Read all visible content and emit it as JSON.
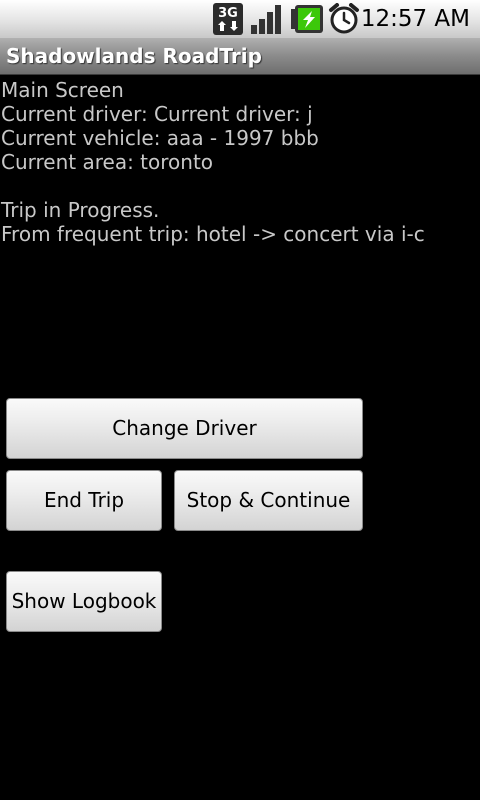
{
  "status_bar": {
    "network_type": "3G",
    "time": "12:57 AM",
    "icons": [
      "3g-data-icon",
      "signal-strength-icon",
      "battery-charging-icon",
      "alarm-clock-icon"
    ]
  },
  "app": {
    "title": "Shadowlands RoadTrip"
  },
  "main": {
    "screen_label": "Main Screen",
    "driver_line": "Current driver: Current driver: j",
    "vehicle_line": "Current vehicle: aaa - 1997 bbb",
    "area_line": "Current area: toronto",
    "trip_status": "Trip in Progress.",
    "trip_detail": "From frequent trip: hotel -> concert via i-c"
  },
  "buttons": {
    "change_driver": "Change Driver",
    "end_trip": "End Trip",
    "stop_continue": "Stop & Continue",
    "show_logbook": "Show Logbook"
  },
  "colors": {
    "background": "#000000",
    "text": "#c8c8c8",
    "title_text": "#ffffff",
    "battery_accent": "#3cc80a"
  }
}
